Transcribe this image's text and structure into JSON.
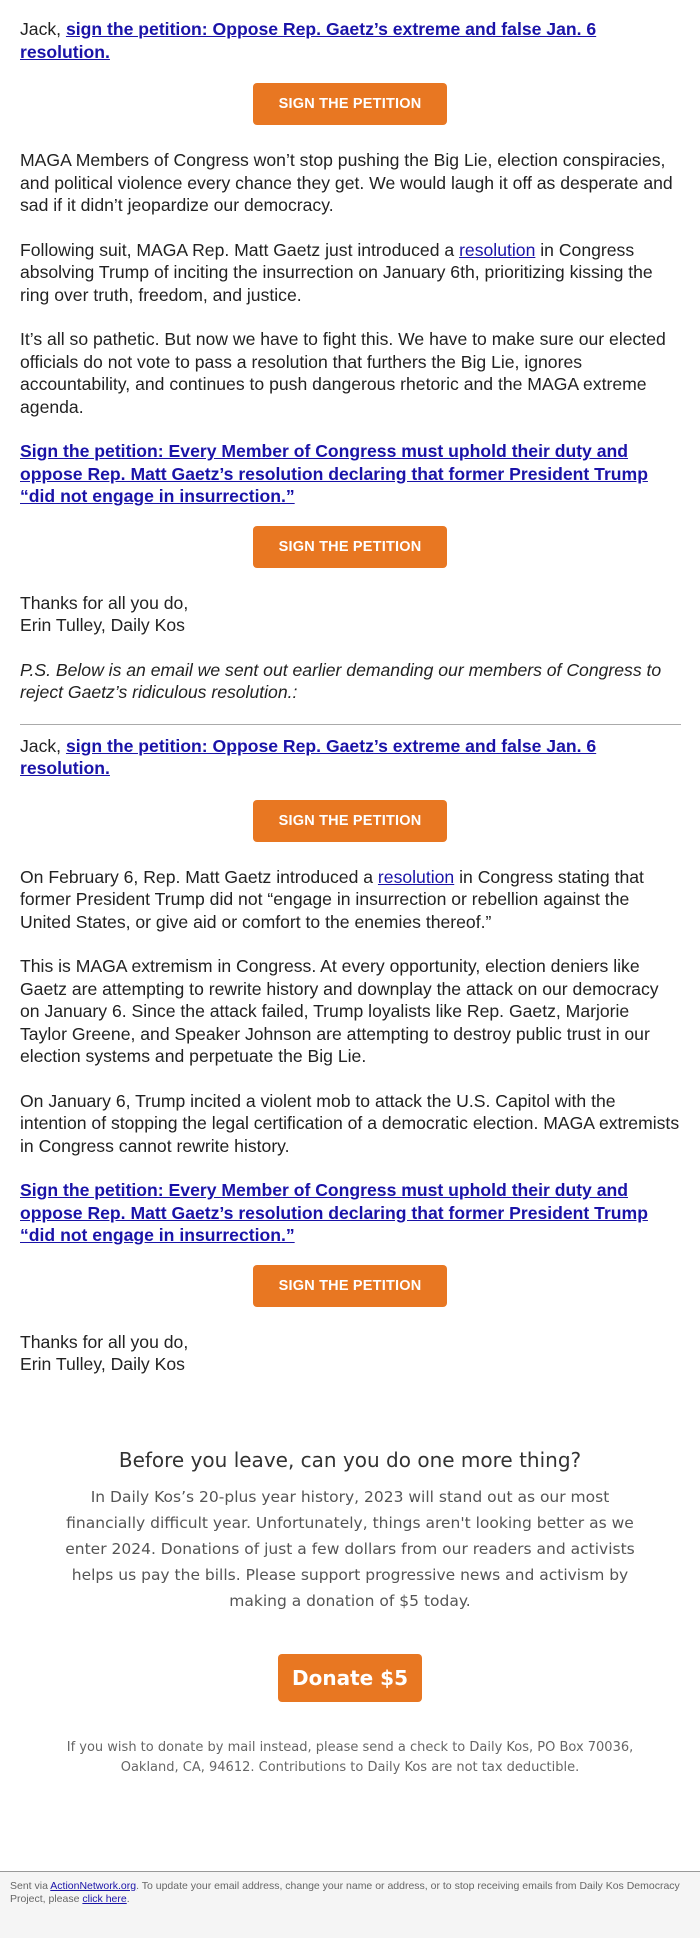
{
  "section1": {
    "greeting": "Jack, ",
    "petition_link": "sign the petition: Oppose Rep. Gaetz’s extreme and false Jan. 6 resolution.",
    "button_label": "SIGN THE PETITION",
    "para1": "MAGA Members of Congress won’t stop pushing the Big Lie, election conspiracies, and political violence every chance they get. We would laugh it off as desperate and sad if it didn’t jeopardize our democracy.",
    "para2_before": "Following suit, MAGA Rep. Matt Gaetz just introduced a ",
    "para2_link": "resolution",
    "para2_after": " in Congress absolving Trump of inciting the insurrection on January 6th, prioritizing kissing the ring over truth, freedom, and justice.",
    "para3": "It’s all so pathetic. But now we have to fight this. We have to make sure our elected officials do not vote to pass a resolution that furthers the Big Lie, ignores accountability, and continues to push dangerous rhetoric and the MAGA extreme agenda.",
    "cta_link": "Sign the petition: Every Member of Congress must uphold their duty and oppose Rep. Matt Gaetz’s resolution declaring that former President Trump “did not engage in insurrection.”",
    "button2_label": "SIGN THE PETITION",
    "thanks": "Thanks for all you do,",
    "signature": "Erin Tulley, Daily Kos",
    "ps": "P.S. Below is an email we sent out earlier demanding our members of Congress to reject Gaetz’s ridiculous resolution.:"
  },
  "section2": {
    "greeting": "Jack, ",
    "petition_link": "sign the petition: Oppose Rep. Gaetz’s extreme and false Jan. 6 resolution.",
    "button_label": "SIGN THE PETITION",
    "para1_before": "On February 6, Rep. Matt Gaetz introduced a ",
    "para1_link": "resolution",
    "para1_after": " in Congress stating that former President Trump did not “engage in insurrection or rebellion against the United States, or give aid or comfort to the enemies thereof.”",
    "para2": "This is MAGA extremism in Congress. At every opportunity, election deniers like Gaetz are attempting to rewrite history and downplay the attack on our democracy on January 6. Since the attack failed, Trump loyalists like Rep. Gaetz, Marjorie Taylor Greene, and Speaker Johnson are attempting to destroy public trust in our election systems and perpetuate the Big Lie.",
    "para3": "On January 6, Trump incited a violent mob to attack the U.S. Capitol with the intention of stopping the legal certification of a democratic election. MAGA extremists in Congress cannot rewrite history.",
    "cta_link": "Sign the petition: Every Member of Congress must uphold their duty and oppose Rep. Matt Gaetz’s resolution declaring that former President Trump “did not engage in insurrection.”",
    "button2_label": "SIGN THE PETITION",
    "thanks": "Thanks for all you do,",
    "signature": "Erin Tulley, Daily Kos"
  },
  "donate": {
    "heading": "Before you leave, can you do one more thing?",
    "body": "In Daily Kos’s 20-plus year history, 2023 will stand out as our most financially difficult year. Unfortunately, things aren't looking better as we enter 2024. Donations of just a few dollars from our readers and activists helps us pay the bills. Please support progressive news and activism by making a donation of $5 today.",
    "button_label": "Donate $5",
    "mail_note": "If you wish to donate by mail instead, please send a check to Daily Kos, PO Box 70036, Oakland, CA, 94612. Contributions to Daily Kos are not tax deductible."
  },
  "footer": {
    "sent_via": "Sent via ",
    "sent_via_link": "ActionNetwork.org",
    "text": ". To update your email address, change your name or address, or to stop receiving emails from Daily Kos Democracy Project, please ",
    "click_here": "click here",
    "end": "."
  },
  "colors": {
    "button_orange": "#e87722",
    "link_blue": "#1a13a8",
    "text_dark": "#222222"
  }
}
